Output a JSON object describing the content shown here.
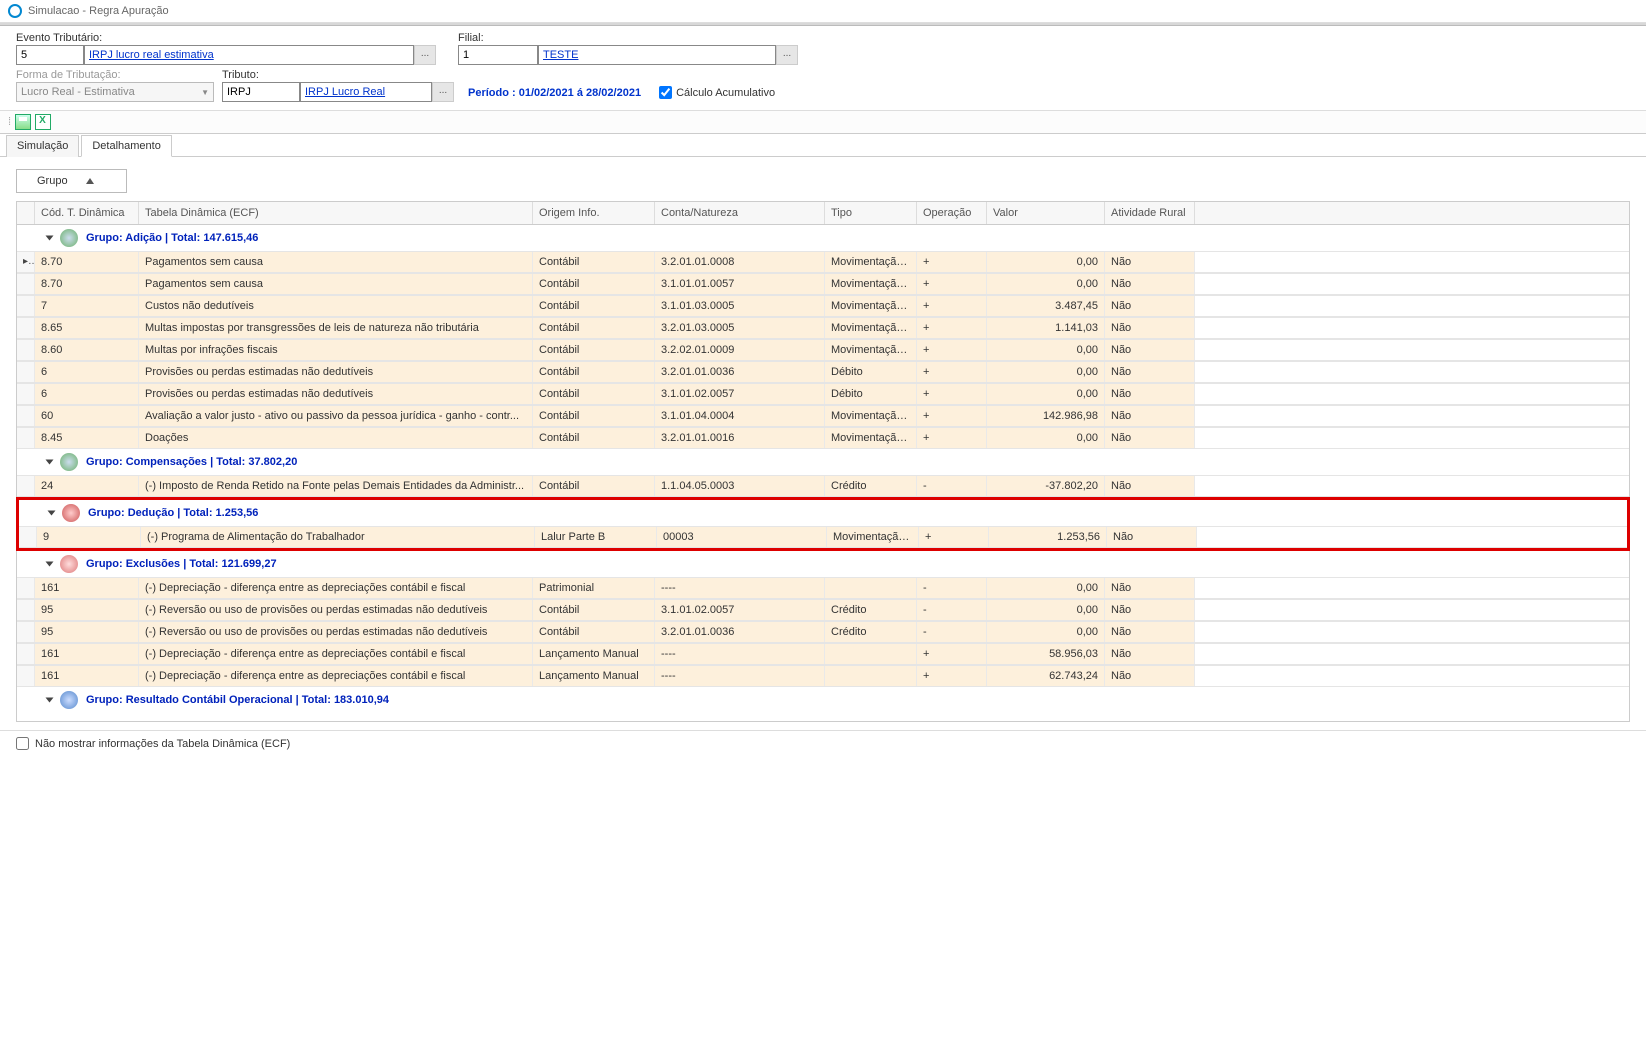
{
  "window": {
    "title": "Simulacao - Regra Apuração"
  },
  "form": {
    "evento_label": "Evento Tributário:",
    "evento_code": "5",
    "evento_link": "IRPJ lucro real estimativa",
    "filial_label": "Filial:",
    "filial_code": "1",
    "filial_link": "TESTE",
    "forma_label": "Forma de Tributação:",
    "forma_value": "Lucro Real - Estimativa",
    "tributo_label": "Tributo:",
    "tributo_code": "IRPJ",
    "tributo_link": "IRPJ Lucro Real",
    "periodo": "Período : 01/02/2021 á 28/02/2021",
    "calc_acum_label": "Cálculo Acumulativo"
  },
  "tabs": {
    "simulacao": "Simulação",
    "detalhamento": "Detalhamento"
  },
  "groupbox": "Grupo",
  "columns": {
    "cod": "Cód. T. Dinâmica",
    "tabela": "Tabela Dinâmica (ECF)",
    "origem": "Origem Info.",
    "conta": "Conta/Natureza",
    "tipo": "Tipo",
    "oper": "Operação",
    "valor": "Valor",
    "rural": "Atividade Rural"
  },
  "groups": {
    "adicao": {
      "label": "Grupo: Adição | Total: 147.615,46"
    },
    "comp": {
      "label": "Grupo: Compensações | Total: 37.802,20"
    },
    "deducao": {
      "label": "Grupo: Dedução | Total: 1.253,56"
    },
    "exclus": {
      "label": "Grupo: Exclusões | Total: 121.699,27"
    },
    "resultado": {
      "label": "Grupo: Resultado Contábil Operacional | Total: 183.010,94"
    }
  },
  "rows": {
    "adicao": [
      {
        "cod": "8.70",
        "tab": "Pagamentos sem causa",
        "orig": "Contábil",
        "conta": "3.2.01.01.0008",
        "tipo": "Movimentação...",
        "op": "+",
        "val": "0,00",
        "rural": "Não"
      },
      {
        "cod": "8.70",
        "tab": "Pagamentos sem causa",
        "orig": "Contábil",
        "conta": "3.1.01.01.0057",
        "tipo": "Movimentação...",
        "op": "+",
        "val": "0,00",
        "rural": "Não"
      },
      {
        "cod": "7",
        "tab": "Custos não dedutíveis",
        "orig": "Contábil",
        "conta": "3.1.01.03.0005",
        "tipo": "Movimentação...",
        "op": "+",
        "val": "3.487,45",
        "rural": "Não"
      },
      {
        "cod": "8.65",
        "tab": "Multas impostas por transgressões de leis de natureza não tributária",
        "orig": "Contábil",
        "conta": "3.2.01.03.0005",
        "tipo": "Movimentação...",
        "op": "+",
        "val": "1.141,03",
        "rural": "Não"
      },
      {
        "cod": "8.60",
        "tab": "Multas por infrações fiscais",
        "orig": "Contábil",
        "conta": "3.2.02.01.0009",
        "tipo": "Movimentação...",
        "op": "+",
        "val": "0,00",
        "rural": "Não"
      },
      {
        "cod": "6",
        "tab": "Provisões ou perdas estimadas não dedutíveis",
        "orig": "Contábil",
        "conta": "3.2.01.01.0036",
        "tipo": "Débito",
        "op": "+",
        "val": "0,00",
        "rural": "Não"
      },
      {
        "cod": "6",
        "tab": "Provisões ou perdas estimadas não dedutíveis",
        "orig": "Contábil",
        "conta": "3.1.01.02.0057",
        "tipo": "Débito",
        "op": "+",
        "val": "0,00",
        "rural": "Não"
      },
      {
        "cod": "60",
        "tab": "Avaliação a valor justo - ativo ou passivo da pessoa jurídica - ganho - contr...",
        "orig": "Contábil",
        "conta": "3.1.01.04.0004",
        "tipo": "Movimentação...",
        "op": "+",
        "val": "142.986,98",
        "rural": "Não"
      },
      {
        "cod": "8.45",
        "tab": "Doações",
        "orig": "Contábil",
        "conta": "3.2.01.01.0016",
        "tipo": "Movimentação...",
        "op": "+",
        "val": "0,00",
        "rural": "Não"
      }
    ],
    "comp": [
      {
        "cod": "24",
        "tab": "(-) Imposto de Renda Retido na Fonte pelas Demais Entidades da Administr...",
        "orig": "Contábil",
        "conta": "1.1.04.05.0003",
        "tipo": "Crédito",
        "op": "-",
        "val": "-37.802,20",
        "rural": "Não"
      }
    ],
    "deducao": [
      {
        "cod": "9",
        "tab": "(-) Programa de Alimentação do Trabalhador",
        "orig": "Lalur Parte B",
        "conta": "00003",
        "tipo": "Movimentação...",
        "op": "+",
        "val": "1.253,56",
        "rural": "Não"
      }
    ],
    "exclus": [
      {
        "cod": "161",
        "tab": "(-) Depreciação - diferença entre as depreciações contábil e fiscal",
        "orig": "Patrimonial",
        "conta": "----",
        "tipo": "",
        "op": "-",
        "val": "0,00",
        "rural": "Não"
      },
      {
        "cod": "95",
        "tab": "(-) Reversão ou uso de provisões ou perdas estimadas não dedutíveis",
        "orig": "Contábil",
        "conta": "3.1.01.02.0057",
        "tipo": "Crédito",
        "op": "-",
        "val": "0,00",
        "rural": "Não"
      },
      {
        "cod": "95",
        "tab": "(-) Reversão ou uso de provisões ou perdas estimadas não dedutíveis",
        "orig": "Contábil",
        "conta": "3.2.01.01.0036",
        "tipo": "Crédito",
        "op": "-",
        "val": "0,00",
        "rural": "Não"
      },
      {
        "cod": "161",
        "tab": "(-) Depreciação - diferença entre as depreciações contábil e fiscal",
        "orig": "Lançamento Manual",
        "conta": "----",
        "tipo": "",
        "op": "+",
        "val": "58.956,03",
        "rural": "Não"
      },
      {
        "cod": "161",
        "tab": "(-) Depreciação - diferença entre as depreciações contábil e fiscal",
        "orig": "Lançamento Manual",
        "conta": "----",
        "tipo": "",
        "op": "+",
        "val": "62.743,24",
        "rural": "Não"
      }
    ]
  },
  "footer": {
    "label": "Não mostrar informações da Tabela Dinâmica (ECF)"
  }
}
